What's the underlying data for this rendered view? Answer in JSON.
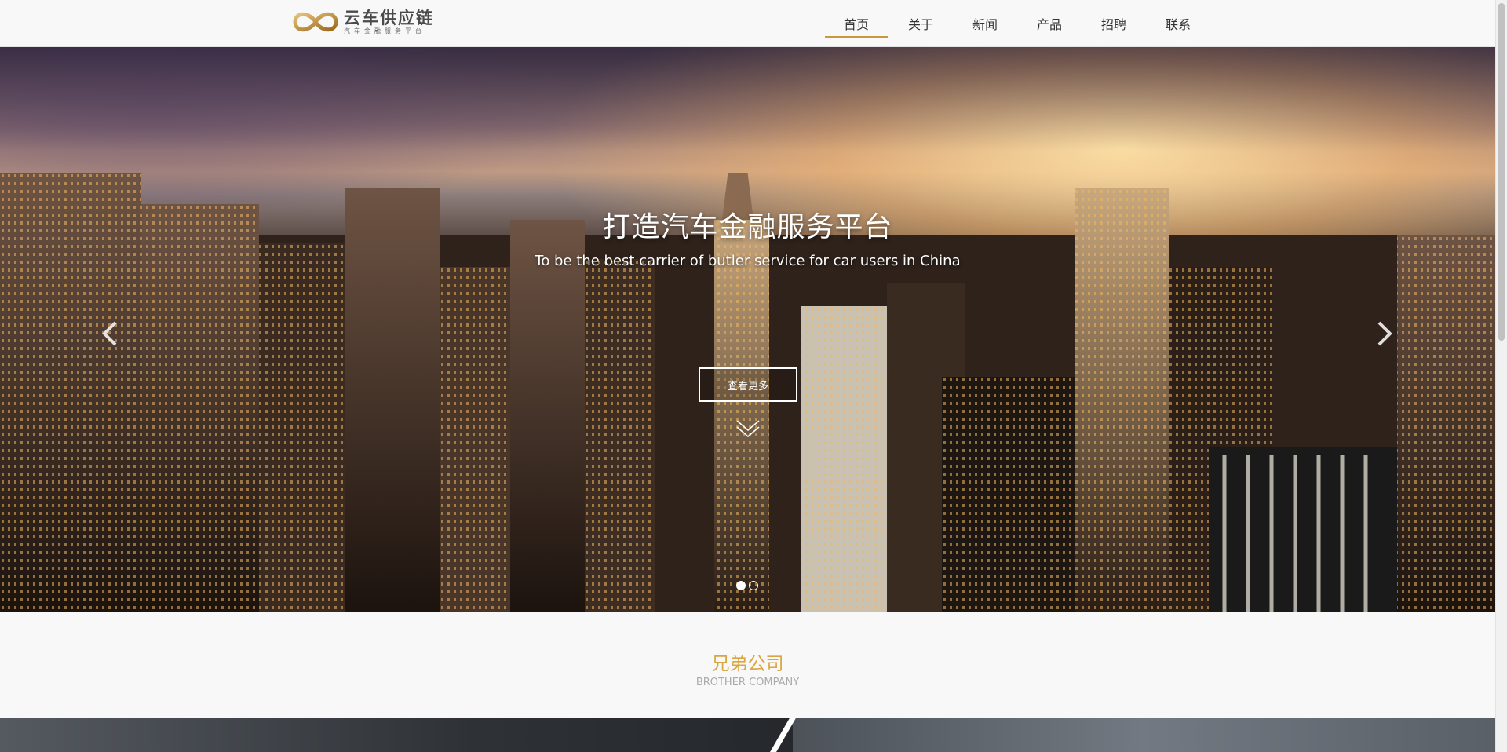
{
  "brand": {
    "name": "云车供应链",
    "tagline": "汽车金融服务平台",
    "colors": {
      "accent": "#c89a3c",
      "section_title": "#d9a642"
    }
  },
  "nav": {
    "items": [
      {
        "label": "首页",
        "active": true
      },
      {
        "label": "关于",
        "active": false
      },
      {
        "label": "新闻",
        "active": false
      },
      {
        "label": "产品",
        "active": false
      },
      {
        "label": "招聘",
        "active": false
      },
      {
        "label": "联系",
        "active": false
      }
    ]
  },
  "hero": {
    "title": "打造汽车金融服务平台",
    "subtitle": "To be the best carrier of butler service for car users in China",
    "button_label": "查看更多",
    "prev_icon": "chevron-left-icon",
    "next_icon": "chevron-right-icon",
    "slides_total": 2,
    "active_slide": 1
  },
  "section": {
    "title": "兄弟公司",
    "subtitle": "BROTHER COMPANY"
  }
}
